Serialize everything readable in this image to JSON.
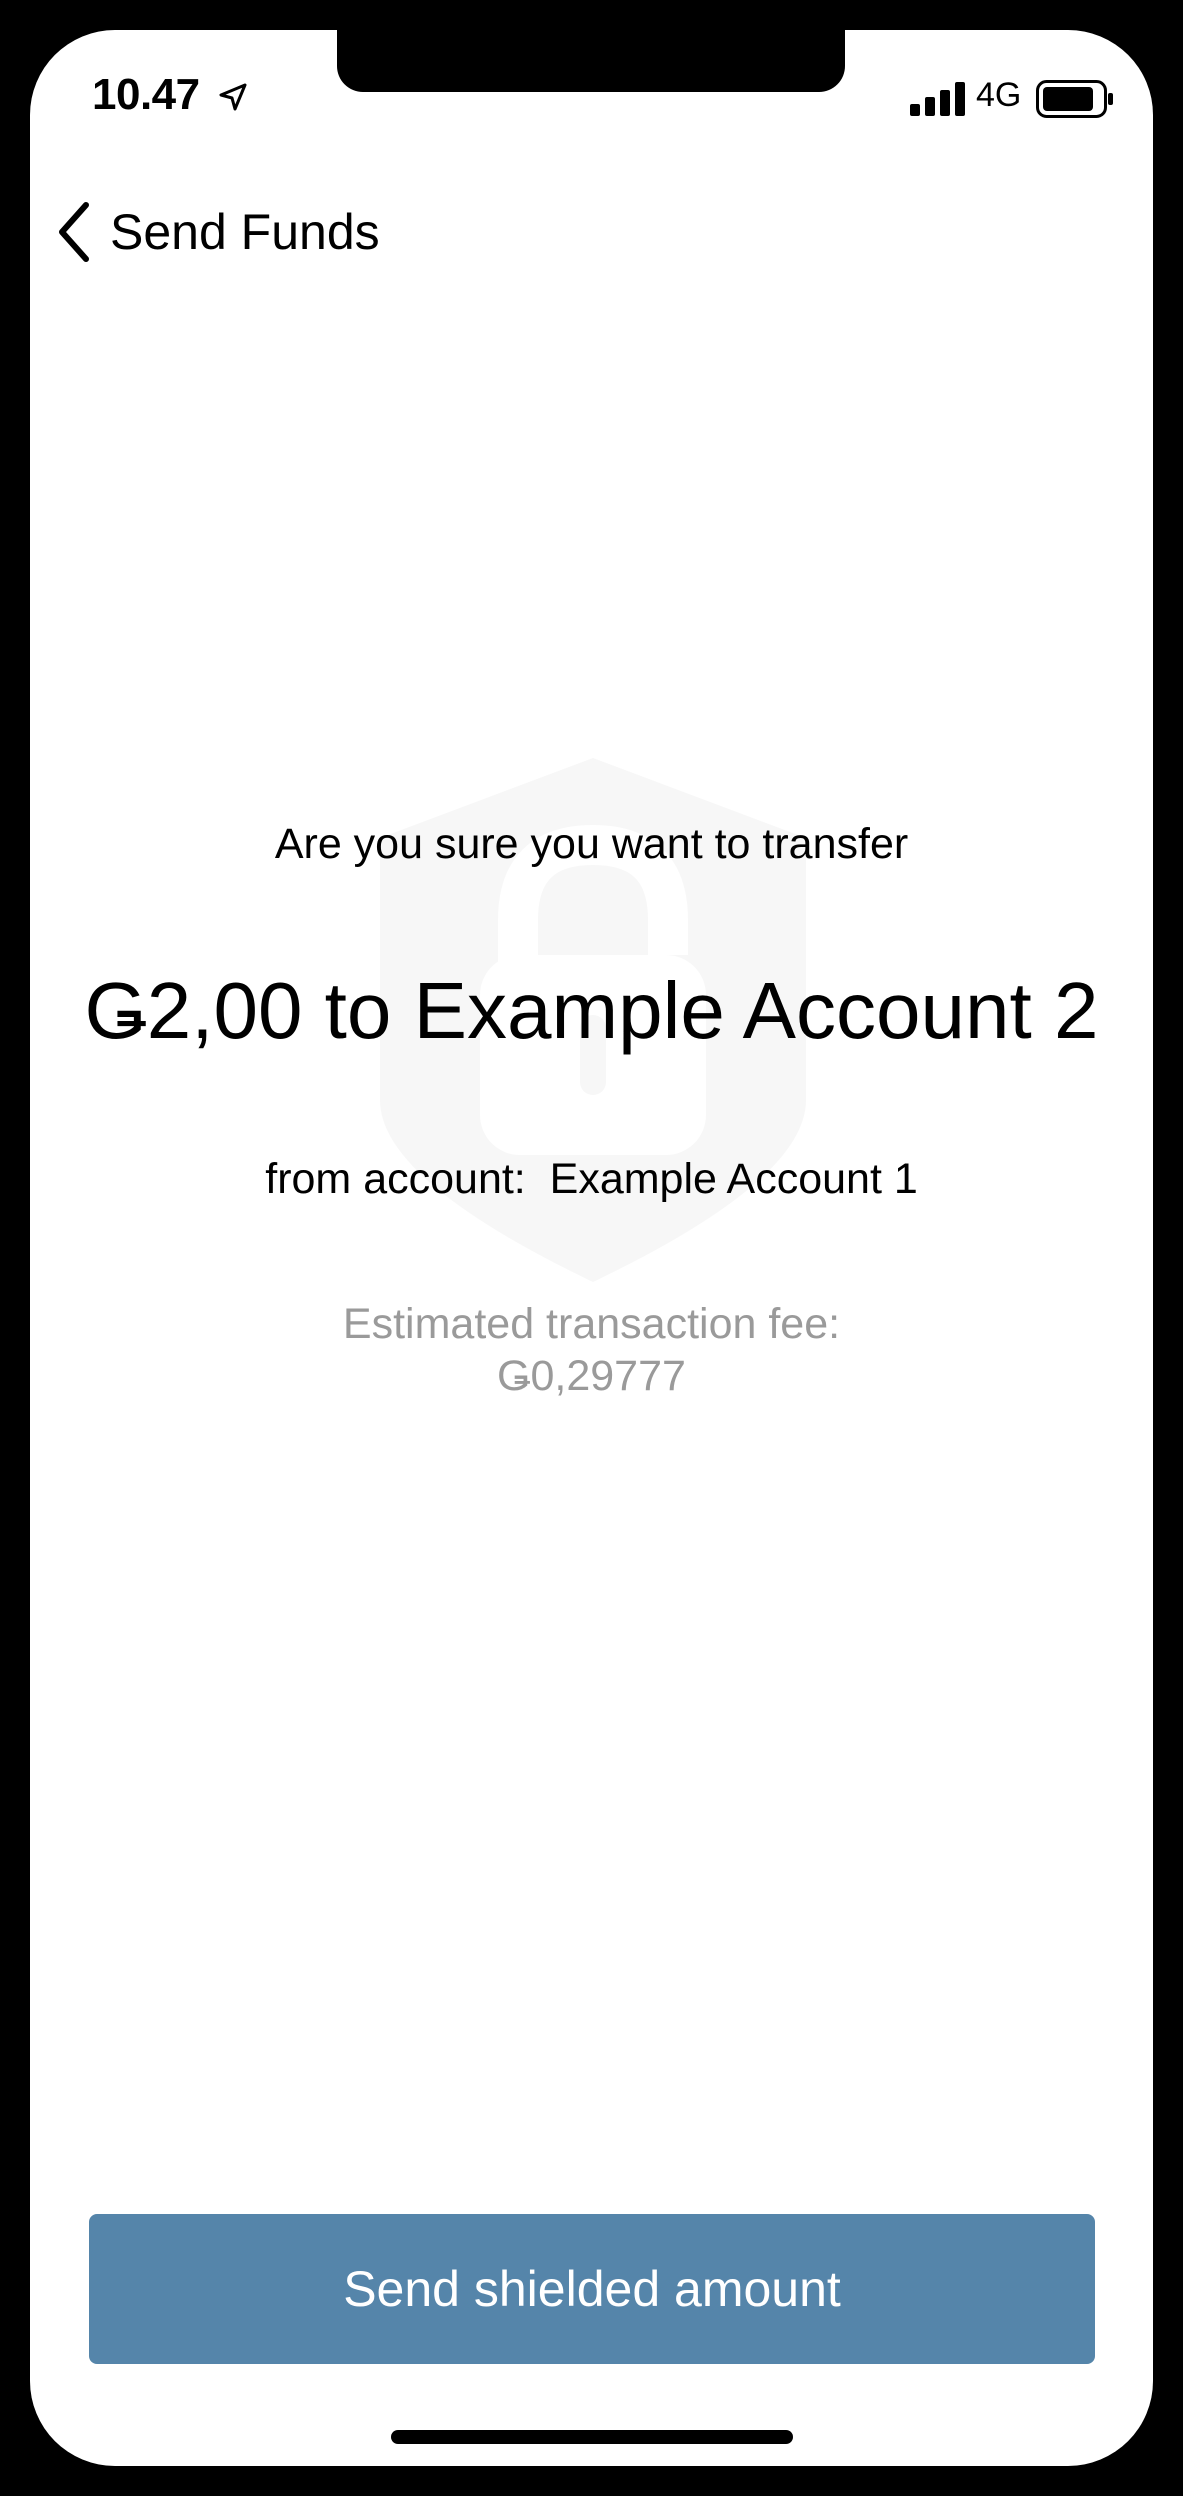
{
  "status_bar": {
    "time": "10.47",
    "network": "4G",
    "icons": [
      "location-arrow-icon",
      "signal-bars-icon",
      "battery-icon"
    ]
  },
  "nav": {
    "back_icon": "chevron-left-icon",
    "title": "Send Funds"
  },
  "confirmation": {
    "question": "Are you sure you want to transfer",
    "amount_line": "Ǥ2,00 to Example Account 2",
    "from_line": "from account:  Example Account 1",
    "fee_label": "Estimated transaction fee:",
    "fee_value": "Ǥ0,29777",
    "watermark_icon": "shield-lock-icon"
  },
  "actions": {
    "send_label": "Send shielded amount"
  },
  "colors": {
    "button": "#5585aa",
    "muted_text": "#9a9a9a",
    "watermark": "#f7f7f7"
  }
}
